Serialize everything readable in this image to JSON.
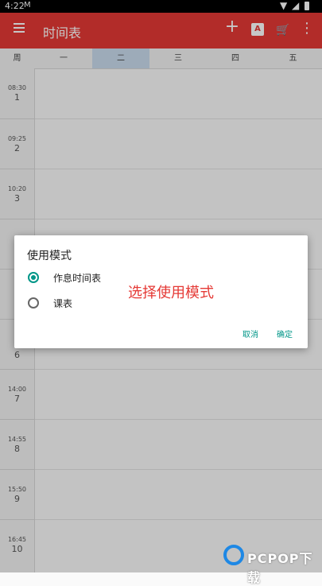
{
  "status_bar": {
    "time": "4:22",
    "mail_icon": "gmail-icon"
  },
  "app_bar": {
    "title": "时间表",
    "add_icon": "+",
    "font_icon": "A"
  },
  "week_header": {
    "corner": "周",
    "days": [
      "一",
      "二",
      "三",
      "四",
      "五"
    ],
    "selected_index": 1
  },
  "periods": [
    {
      "time": "08:30",
      "num": "1"
    },
    {
      "time": "09:25",
      "num": "2"
    },
    {
      "time": "10:20",
      "num": "3"
    },
    {
      "time": "",
      "num": ""
    },
    {
      "time": "",
      "num": ""
    },
    {
      "time": "",
      "num": "6"
    },
    {
      "time": "14:00",
      "num": "7"
    },
    {
      "time": "14:55",
      "num": "8"
    },
    {
      "time": "15:50",
      "num": "9"
    },
    {
      "time": "16:45",
      "num": "10"
    }
  ],
  "dialog": {
    "title": "使用模式",
    "options": [
      {
        "label": "作息时间表",
        "checked": true
      },
      {
        "label": "课表",
        "checked": false
      }
    ],
    "annotation": "选择使用模式",
    "cancel": "取消",
    "confirm": "确定"
  },
  "watermark": {
    "text": "PCPOP下载"
  },
  "colors": {
    "app_bar": "#e53935",
    "accent": "#009688",
    "annotation": "#e53935"
  }
}
